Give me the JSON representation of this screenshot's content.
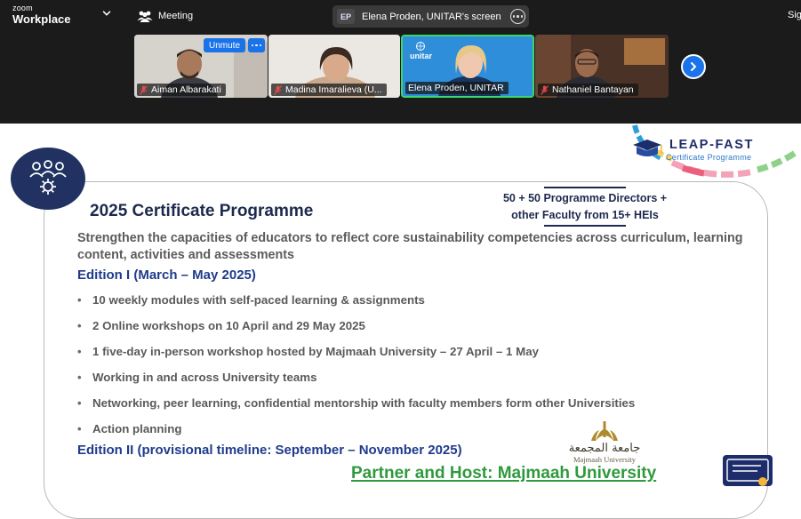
{
  "topbar": {
    "brand_small": "zoom",
    "brand_large": "Workplace",
    "meeting_label": "Meeting",
    "share_avatar": "EP",
    "share_text": "Elena Proden, UNITAR's screen",
    "signin_label": "Sig"
  },
  "participants": [
    {
      "name": "Aiman Albarakati",
      "muted": true
    },
    {
      "name": "Madina Imaralieva (U...",
      "muted": true
    },
    {
      "name": "Elena Proden, UNITAR",
      "muted": false,
      "active_speaker": true
    },
    {
      "name": "Nathaniel Bantayan",
      "muted": true
    }
  ],
  "tile_controls": {
    "unmute_label": "Unmute"
  },
  "unitar_logo": "unitar",
  "slide": {
    "logo_title": "LEAP-FAST",
    "logo_subtitle": "Certificate Programme",
    "title": "2025 Certificate Programme",
    "directors_line1": "50 + 50 Programme Directors +",
    "directors_line2": "other Faculty from 15+ HEIs",
    "lead": "Strengthen the capacities of educators to reflect core sustainability competencies across curriculum, learning content, activities and assessments",
    "edition1": "Edition I (March – May 2025)",
    "bullets": [
      "10 weekly modules with self-paced learning & assignments",
      "2 Online workshops on 10 April and 29 May 2025",
      "1 five-day in-person workshop hosted by Majmaah University – 27 April – 1 May",
      "Working in and across University teams",
      "Networking, peer learning, confidential mentorship with faculty members form other Universities",
      "Action planning"
    ],
    "edition2": "Edition II (provisional timeline: September – November 2025)",
    "university_ar": "جامعة المجمعة",
    "university_en": "Majmaah University",
    "partner": "Partner and Host: Majmaah University"
  },
  "colors": {
    "zoom_bg": "#1b1b1b",
    "zoom_blue": "#1a73e8",
    "active_border": "#3ad86a",
    "navy": "#1d2a4e",
    "edition_blue": "#1f3c8c",
    "partner_green": "#2f9a3c"
  }
}
